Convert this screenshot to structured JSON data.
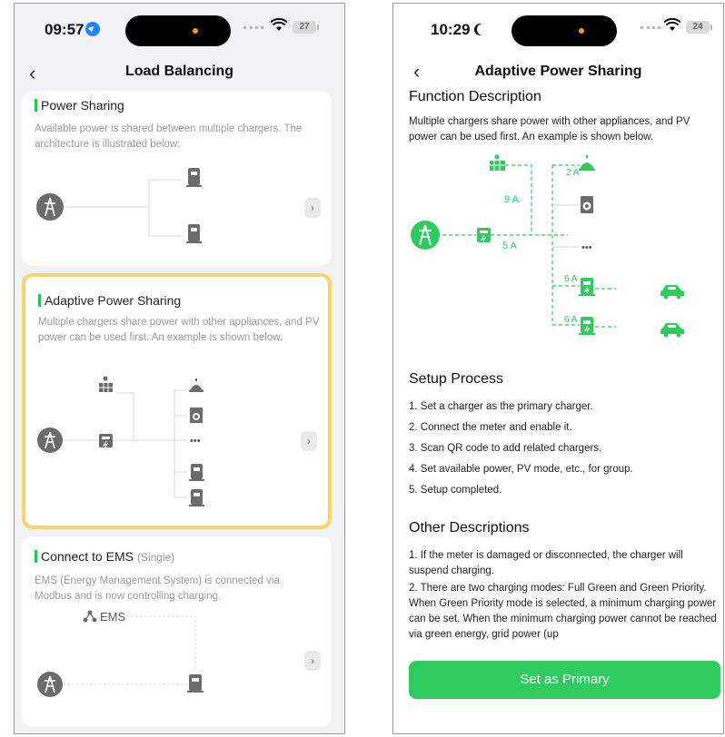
{
  "colors": {
    "accent_green": "#2fcb5f",
    "selected_border": "#f6d668",
    "dynamic_island_dot": "#f59a1b"
  },
  "left_screen": {
    "status_time": "09:57",
    "battery": "27",
    "title": "Load Balancing",
    "cards": [
      {
        "title": "Power Sharing",
        "description": "Available power is shared between multiple chargers. The architecture is illustrated below:"
      },
      {
        "title": "Adaptive Power Sharing",
        "description": "Multiple chargers share power with other appliances, and PV power can be used first. An example is shown below.",
        "ellipsis": "•••"
      },
      {
        "title": "Connect to EMS",
        "subtitle": "(Single)",
        "description": "EMS (Energy Management System) is connected via Modbus and is now controlling charging.",
        "ems_label": "EMS"
      }
    ]
  },
  "right_screen": {
    "status_time": "10:29",
    "battery": "24",
    "title": "Adaptive Power Sharing",
    "function_title": "Function Description",
    "function_text": "Multiple chargers share power with other appliances, and PV power can be used first. An example is shown below.",
    "diagram": {
      "pv_current": "9 A",
      "meter_current": "5 A",
      "appliance_current": "2 A",
      "charger1_current": "6 A",
      "charger2_current": "6 A",
      "ellipsis": "•••"
    },
    "setup_title": "Setup Process",
    "setup_steps": [
      "1. Set a charger as the primary charger.",
      "2. Connect the meter and enable it.",
      "3. Scan QR code to add related chargers.",
      "4. Set available power, PV mode, etc., for group.",
      "5. Setup completed."
    ],
    "other_title": "Other Descriptions",
    "other_text_1": "1. If the meter is damaged or disconnected, the charger will suspend charging.",
    "other_text_2": "2. There are two charging modes: Full Green and Green Priority. When Green Priority mode is selected, a minimum charging power can be set. When the minimum charging power cannot be reached via green energy, grid power (up",
    "primary_button": "Set as Primary"
  }
}
